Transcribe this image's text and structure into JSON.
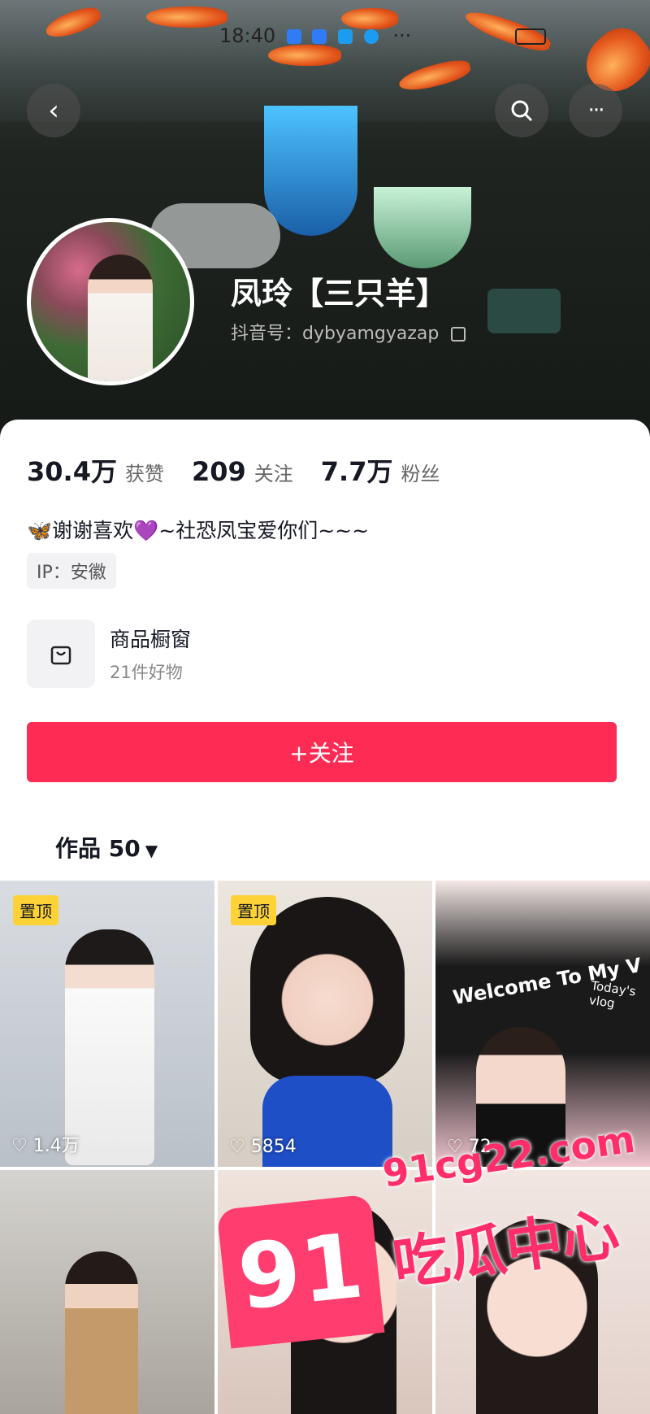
{
  "status_bar": {
    "time": "18:40",
    "more": "···"
  },
  "header": {
    "back_icon": "chevron-left-icon",
    "search_icon": "search-icon",
    "more_icon": "more-dots-icon",
    "more_label": "···"
  },
  "profile": {
    "name": "凤玲【三只羊】",
    "handle_label": "抖音号：",
    "handle": "dybyamgyazap",
    "copy_icon": "copy-icon"
  },
  "stats": [
    {
      "value": "30.4万",
      "label": "获赞"
    },
    {
      "value": "209",
      "label": "关注"
    },
    {
      "value": "7.7万",
      "label": "粉丝"
    }
  ],
  "bio": "🦋谢谢喜欢💜~社恐凤宝爱你们~~~",
  "ip": "IP：安徽",
  "shop": {
    "title": "商品橱窗",
    "subtitle": "21件好物",
    "icon": "bag-icon"
  },
  "follow_button": "+关注",
  "tabs": {
    "works_label": "作品 50",
    "caret": "▼"
  },
  "videos": [
    {
      "pinned": "置顶",
      "likes": "1.4万"
    },
    {
      "pinned": "置顶",
      "likes": "5854"
    },
    {
      "pinned": "",
      "likes": "72"
    },
    {
      "pinned": "",
      "likes": ""
    },
    {
      "pinned": "",
      "likes": ""
    },
    {
      "pinned": "",
      "likes": ""
    }
  ],
  "overlay_text": {
    "welcome": "Welcome To My V",
    "today": "Today's vlog"
  },
  "watermark": {
    "badge": "91",
    "url": "91cg22.com",
    "brand": "吃瓜中心"
  },
  "colors": {
    "accent": "#fe2c55",
    "pin": "#fdd236",
    "watermark": "#ff2e6a"
  }
}
